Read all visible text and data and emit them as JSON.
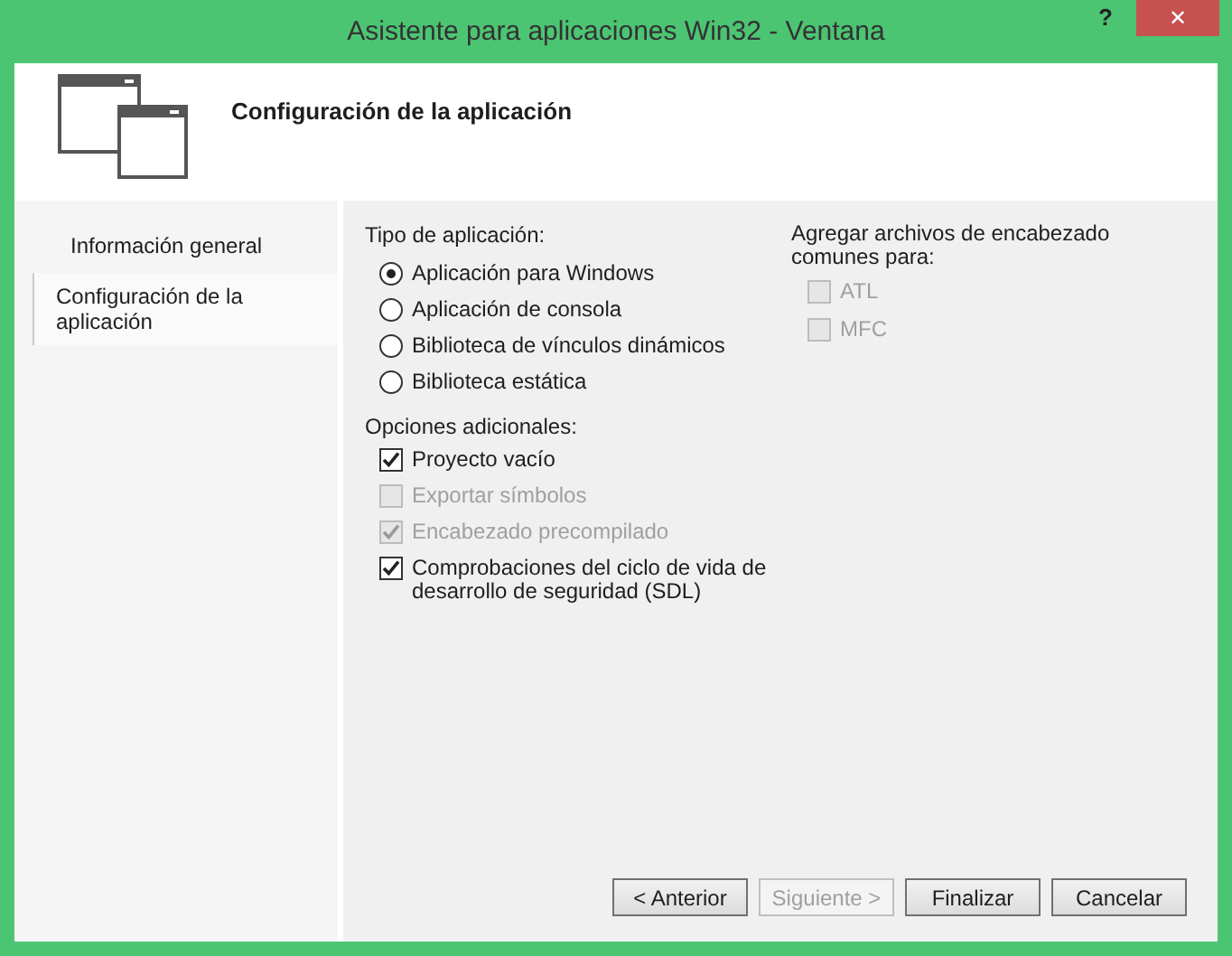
{
  "window": {
    "title": "Asistente para aplicaciones Win32 - Ventana",
    "help": "?",
    "close": "✕"
  },
  "header": {
    "title": "Configuración de la aplicación"
  },
  "sidebar": {
    "items": [
      {
        "label": "Información general",
        "selected": false
      },
      {
        "label": "Configuración de la aplicación",
        "selected": true
      }
    ]
  },
  "application_type": {
    "label": "Tipo de aplicación:",
    "options": [
      {
        "label": "Aplicación para Windows",
        "selected": true
      },
      {
        "label": "Aplicación de consola",
        "selected": false
      },
      {
        "label": "Biblioteca de vínculos dinámicos",
        "selected": false
      },
      {
        "label": "Biblioteca estática",
        "selected": false
      }
    ]
  },
  "additional_options": {
    "label": "Opciones adicionales:",
    "options": [
      {
        "label": "Proyecto vacío",
        "checked": true,
        "disabled": false
      },
      {
        "label": "Exportar símbolos",
        "checked": false,
        "disabled": true
      },
      {
        "label": "Encabezado precompilado",
        "checked": true,
        "disabled": true
      },
      {
        "label": "Comprobaciones del ciclo de vida de desarrollo de seguridad (SDL)",
        "checked": true,
        "disabled": false
      }
    ]
  },
  "common_headers": {
    "label": "Agregar archivos de encabezado comunes para:",
    "options": [
      {
        "label": "ATL",
        "checked": false,
        "disabled": true
      },
      {
        "label": "MFC",
        "checked": false,
        "disabled": true
      }
    ]
  },
  "buttons": [
    {
      "label": "< Anterior",
      "disabled": false
    },
    {
      "label": "Siguiente >",
      "disabled": true
    },
    {
      "label": "Finalizar",
      "disabled": false
    },
    {
      "label": "Cancelar",
      "disabled": false
    }
  ]
}
